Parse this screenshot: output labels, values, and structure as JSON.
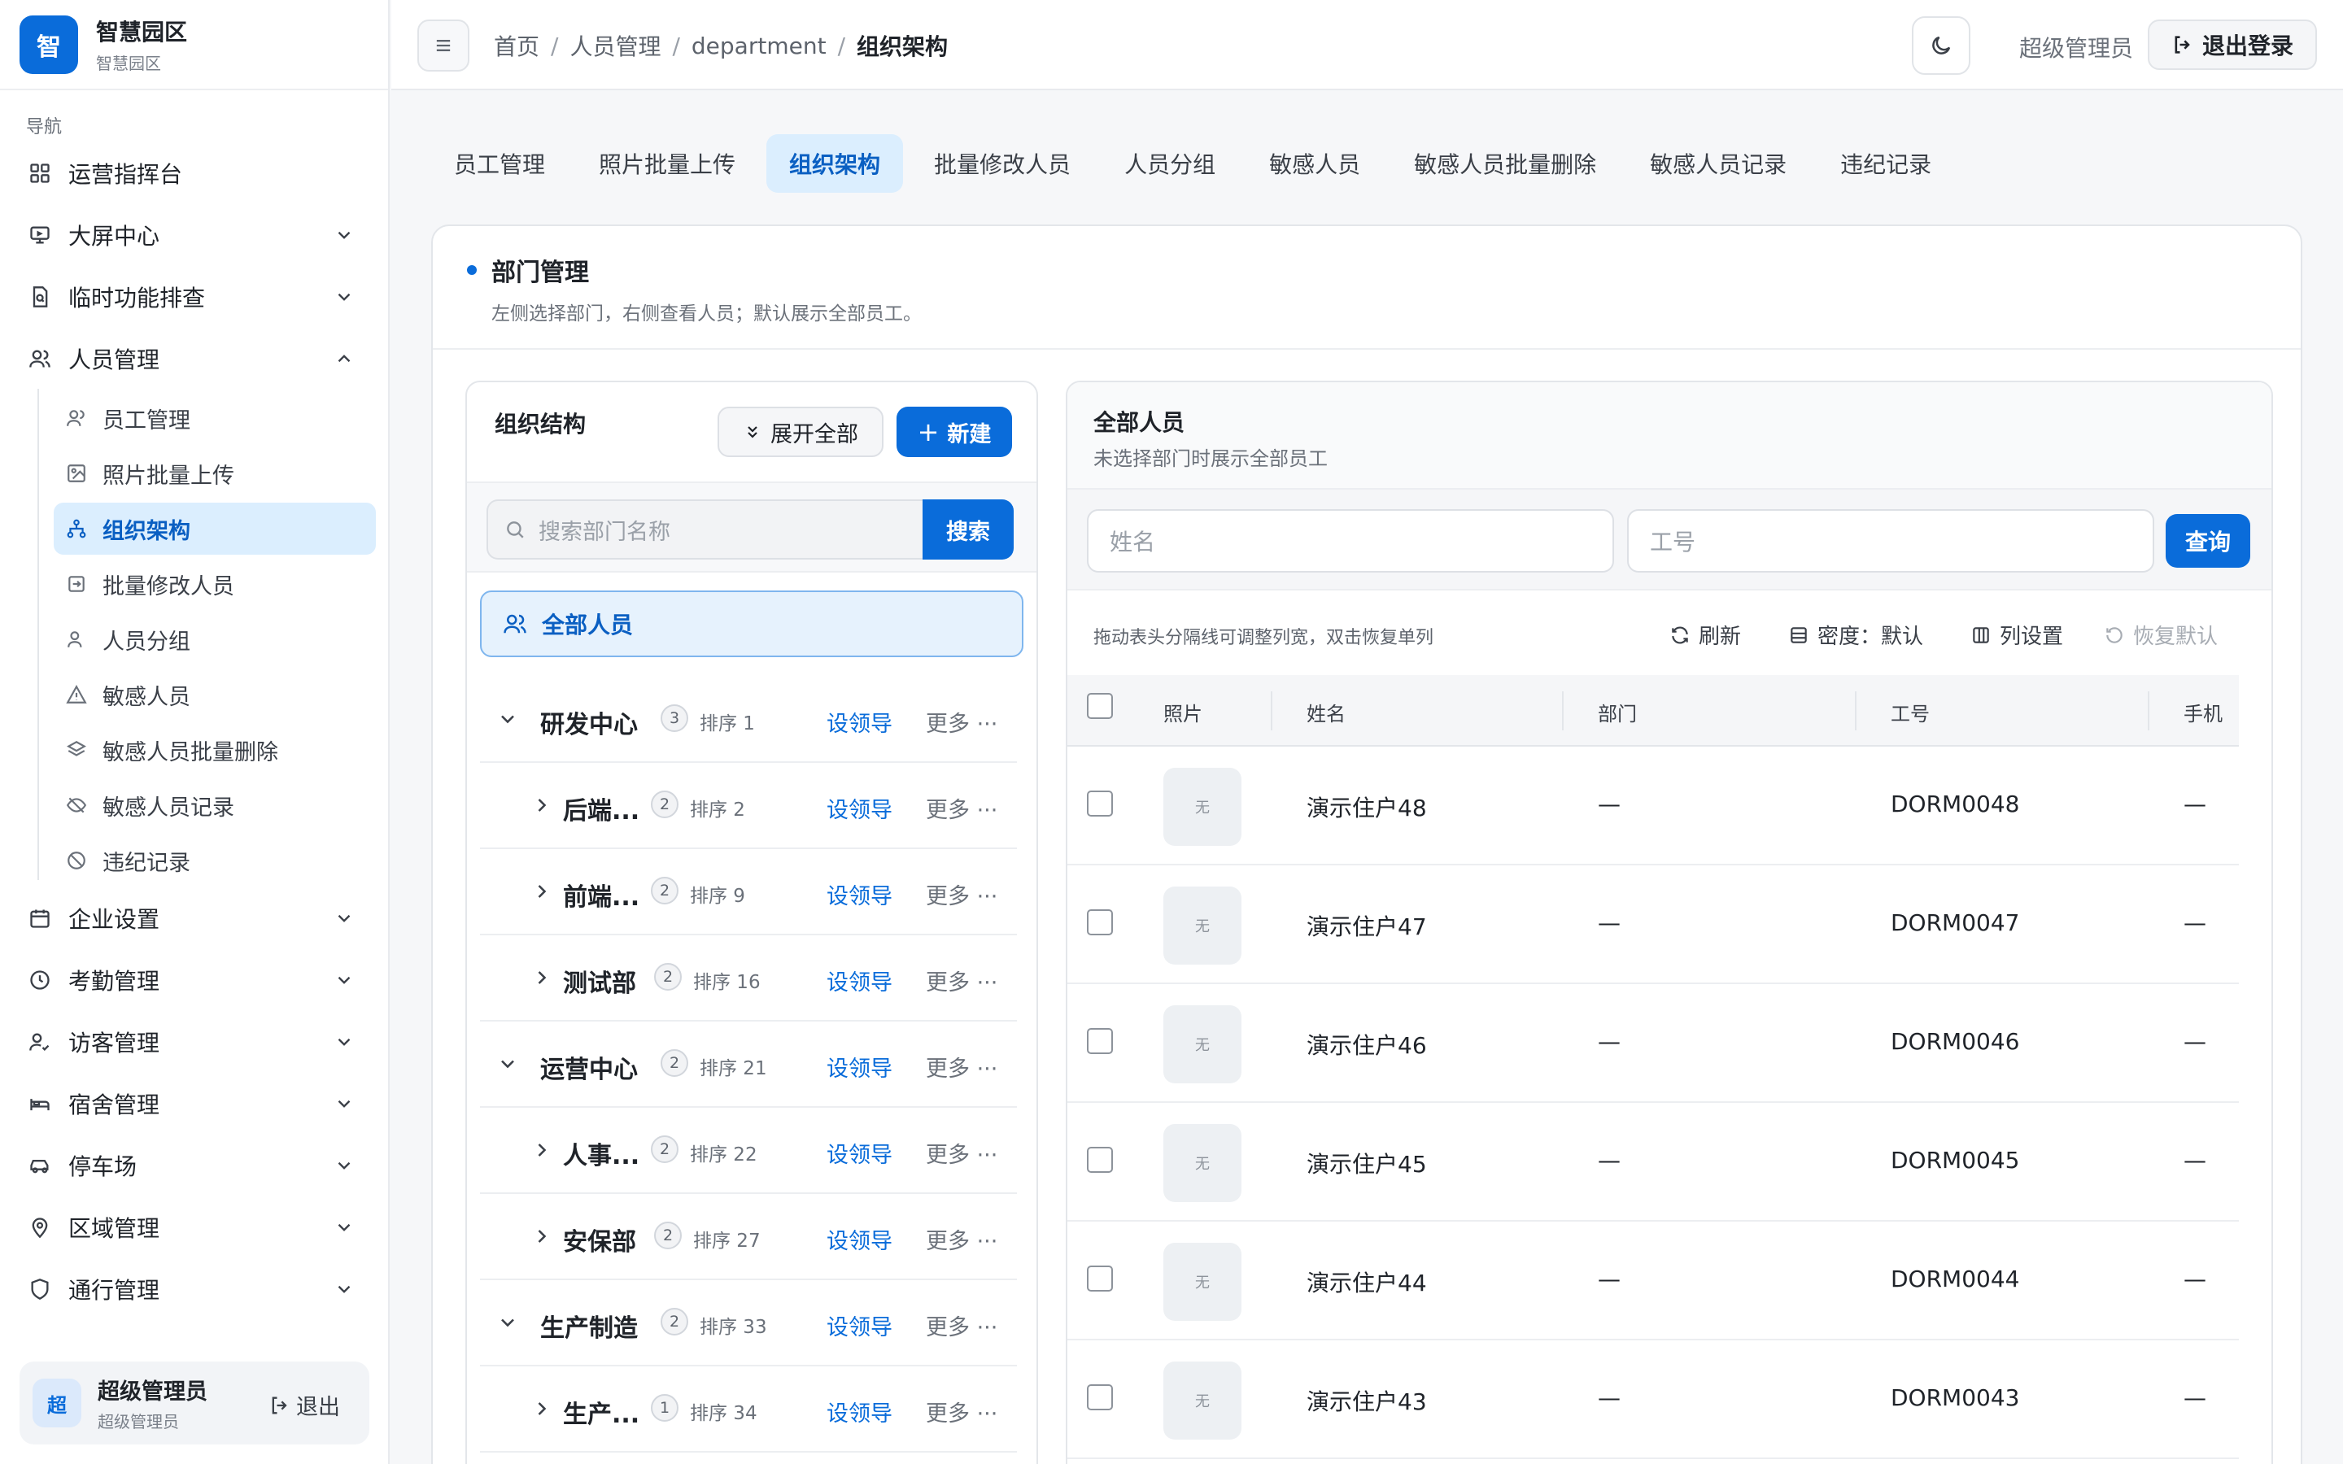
{
  "brand": {
    "logo": "智",
    "title": "智慧园区",
    "subtitle": "智慧园区"
  },
  "sidebar": {
    "caption": "导航",
    "items": [
      {
        "label": "运营指挥台",
        "icon": "dashboard-icon"
      },
      {
        "label": "大屏中心",
        "icon": "monitor-icon"
      },
      {
        "label": "临时功能排查",
        "icon": "file-search-icon"
      },
      {
        "label": "人员管理",
        "icon": "users-icon"
      },
      {
        "label": "企业设置",
        "icon": "calendar-icon"
      },
      {
        "label": "考勤管理",
        "icon": "clock-icon"
      },
      {
        "label": "访客管理",
        "icon": "user-check-icon"
      },
      {
        "label": "宿舍管理",
        "icon": "bed-icon"
      },
      {
        "label": "停车场",
        "icon": "car-icon"
      },
      {
        "label": "区域管理",
        "icon": "map-pin-icon"
      },
      {
        "label": "通行管理",
        "icon": "shield-icon"
      }
    ],
    "sub_items": [
      {
        "label": "员工管理",
        "icon": "users-icon"
      },
      {
        "label": "照片批量上传",
        "icon": "image-upload-icon"
      },
      {
        "label": "组织架构",
        "icon": "org-tree-icon"
      },
      {
        "label": "批量修改人员",
        "icon": "user-edit-icon"
      },
      {
        "label": "人员分组",
        "icon": "user-group-icon"
      },
      {
        "label": "敏感人员",
        "icon": "warning-icon"
      },
      {
        "label": "敏感人员批量删除",
        "icon": "layers-icon"
      },
      {
        "label": "敏感人员记录",
        "icon": "eye-off-icon"
      },
      {
        "label": "违纪记录",
        "icon": "ban-icon"
      }
    ],
    "user": {
      "avatar": "超",
      "name": "超级管理员",
      "role": "超级管理员",
      "logout": "退出"
    }
  },
  "header": {
    "breadcrumb": [
      "首页",
      "人员管理",
      "department",
      "组织架构"
    ],
    "user": "超级管理员",
    "logout": "退出登录"
  },
  "tabs": [
    "员工管理",
    "照片批量上传",
    "组织架构",
    "批量修改人员",
    "人员分组",
    "敏感人员",
    "敏感人员批量删除",
    "敏感人员记录",
    "违纪记录"
  ],
  "card": {
    "title": "部门管理",
    "desc": "左侧选择部门，右侧查看人员；默认展示全部员工。"
  },
  "org": {
    "title": "组织结构",
    "expand_all": "展开全部",
    "new": "新建",
    "search_placeholder": "搜索部门名称",
    "search_btn": "搜索",
    "all_people": "全部人员",
    "leader_label": "设领导",
    "more_label": "更多 ···",
    "tree": [
      {
        "name": "研发中心",
        "count": "3",
        "sort": "排序 1",
        "level": 0,
        "expanded": true
      },
      {
        "name": "后端...",
        "count": "2",
        "sort": "排序 2",
        "level": 1,
        "expanded": false
      },
      {
        "name": "前端...",
        "count": "2",
        "sort": "排序 9",
        "level": 1,
        "expanded": false
      },
      {
        "name": "测试部",
        "count": "2",
        "sort": "排序 16",
        "level": 1,
        "expanded": false
      },
      {
        "name": "运营中心",
        "count": "2",
        "sort": "排序 21",
        "level": 0,
        "expanded": true
      },
      {
        "name": "人事...",
        "count": "2",
        "sort": "排序 22",
        "level": 1,
        "expanded": false
      },
      {
        "name": "安保部",
        "count": "2",
        "sort": "排序 27",
        "level": 1,
        "expanded": false
      },
      {
        "name": "生产制造",
        "count": "2",
        "sort": "排序 33",
        "level": 0,
        "expanded": true
      },
      {
        "name": "生产...",
        "count": "1",
        "sort": "排序 34",
        "level": 1,
        "expanded": false
      }
    ]
  },
  "people": {
    "title": "全部人员",
    "desc": "未选择部门时展示全部员工",
    "name_placeholder": "姓名",
    "id_placeholder": "工号",
    "query": "查询",
    "hint": "拖动表头分隔线可调整列宽，双击恢复单列",
    "refresh": "刷新",
    "density": "密度：默认",
    "columns_setting": "列设置",
    "reset": "恢复默认",
    "columns": [
      "照片",
      "姓名",
      "部门",
      "工号",
      "手机"
    ],
    "photo_placeholder": "无",
    "rows": [
      {
        "name": "演示住户48",
        "dept": "—",
        "id": "DORM0048",
        "phone": "—"
      },
      {
        "name": "演示住户47",
        "dept": "—",
        "id": "DORM0047",
        "phone": "—"
      },
      {
        "name": "演示住户46",
        "dept": "—",
        "id": "DORM0046",
        "phone": "—"
      },
      {
        "name": "演示住户45",
        "dept": "—",
        "id": "DORM0045",
        "phone": "—"
      },
      {
        "name": "演示住户44",
        "dept": "—",
        "id": "DORM0044",
        "phone": "—"
      },
      {
        "name": "演示住户43",
        "dept": "—",
        "id": "DORM0043",
        "phone": "—"
      }
    ]
  },
  "colors": {
    "primary": "#0a6cda",
    "active_bg": "#dbeefe"
  }
}
